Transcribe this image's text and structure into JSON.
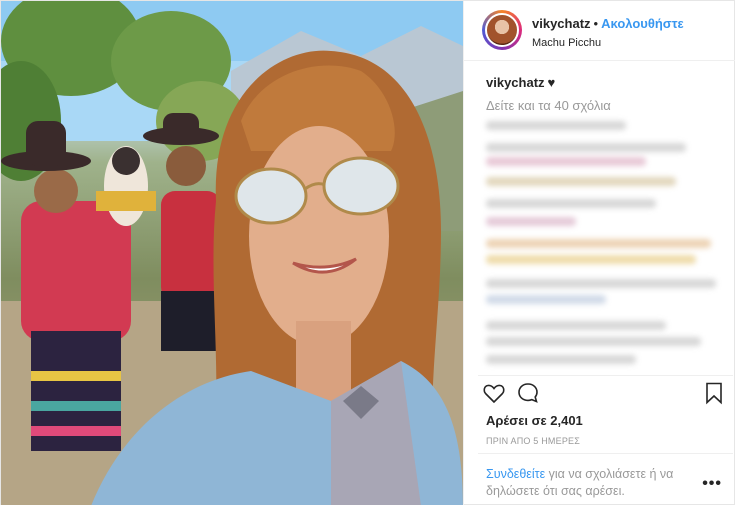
{
  "post": {
    "username": "vikychatz",
    "separator": "•",
    "follow_label": "Ακολουθήστε",
    "location": "Machu Picchu",
    "caption_user": "vikychatz",
    "caption_text": "♥",
    "view_comments": "Δείτε και τα 40 σχόλια",
    "likes": "Αρέσει σε 2,401",
    "timestamp": "ΠΡΙΝ ΑΠΟ 5 ΗΜΕΡΕΣ",
    "login_link": "Συνδεθείτε",
    "login_text": " για να σχολιάσετε ή να δηλώσετε ότι σας αρέσει.",
    "more": "•••"
  },
  "icons": {
    "like": "heart-outline-icon",
    "comment": "speech-bubble-icon",
    "save": "bookmark-icon",
    "more": "ellipsis-icon"
  },
  "colors": {
    "link_blue": "#3897f0",
    "text_dark": "#262626",
    "text_gray": "#999999",
    "border": "#efefef"
  }
}
